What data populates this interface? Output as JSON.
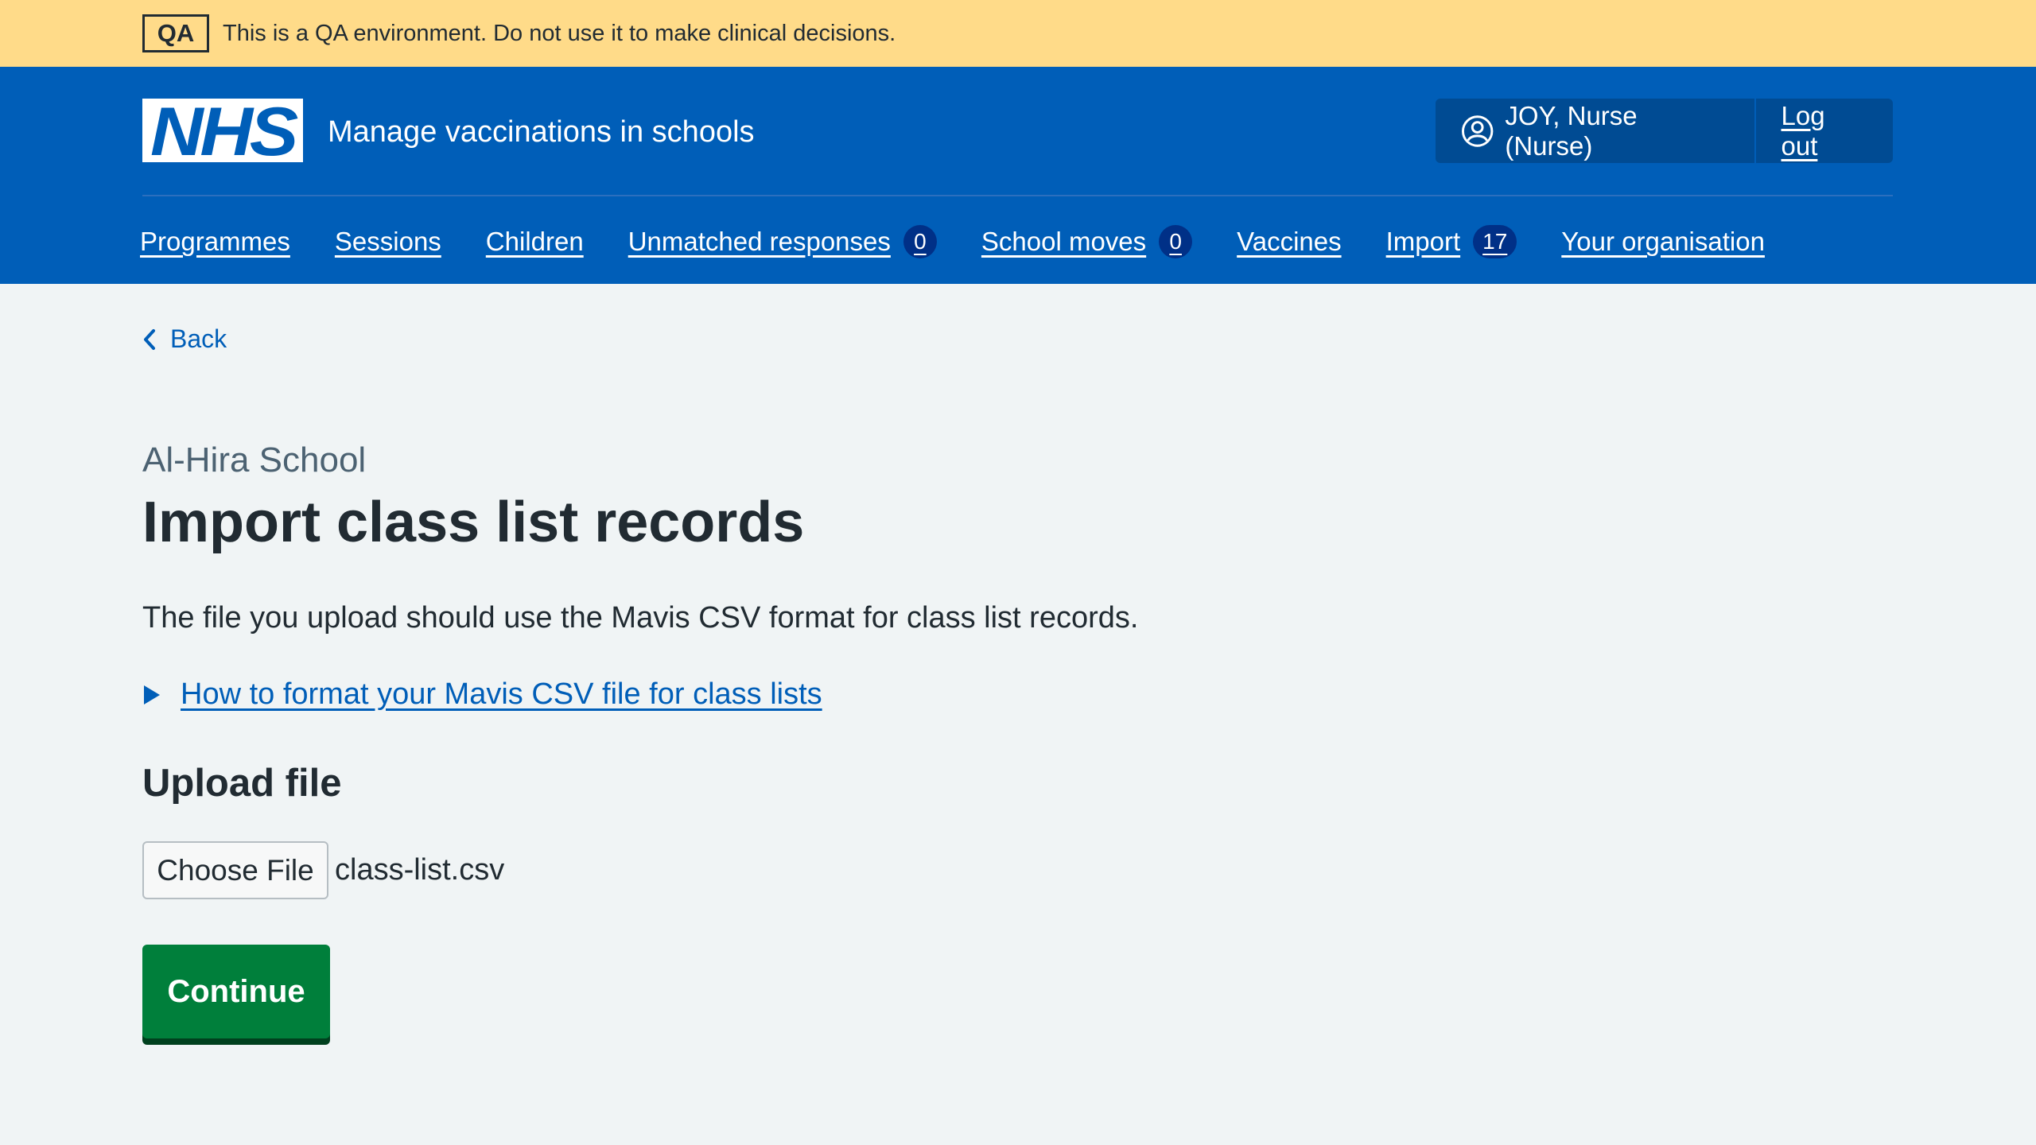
{
  "environment_banner": {
    "tag": "QA",
    "message": "This is a QA environment. Do not use it to make clinical decisions.",
    "color": "#ffdb89"
  },
  "header": {
    "logo_text": "NHS",
    "service_name": "Manage vaccinations in schools",
    "account": {
      "icon": "user-circle-icon",
      "user_label": "JOY, Nurse (Nurse)",
      "logout_label": "Log out"
    },
    "color": "#005eb8"
  },
  "nav": {
    "items": [
      {
        "label": "Programmes"
      },
      {
        "label": "Sessions"
      },
      {
        "label": "Children"
      },
      {
        "label": "Unmatched responses",
        "count": "0"
      },
      {
        "label": "School moves",
        "count": "0"
      },
      {
        "label": "Vaccines"
      },
      {
        "label": "Import",
        "count": "17"
      },
      {
        "label": "Your organisation"
      }
    ]
  },
  "back_link": {
    "icon": "chevron-left-icon",
    "label": "Back"
  },
  "main": {
    "caption": "Al-Hira School",
    "title": "Import class list records",
    "lede": "The file you upload should use the Mavis CSV format for class list records.",
    "details": {
      "icon": "triangle-right-icon",
      "summary": "How to format your Mavis CSV file for class lists"
    },
    "upload": {
      "label": "Upload file",
      "button_label": "Choose File",
      "file_name": "class-list.csv"
    },
    "continue_label": "Continue",
    "continue_color": "#007f3b"
  }
}
